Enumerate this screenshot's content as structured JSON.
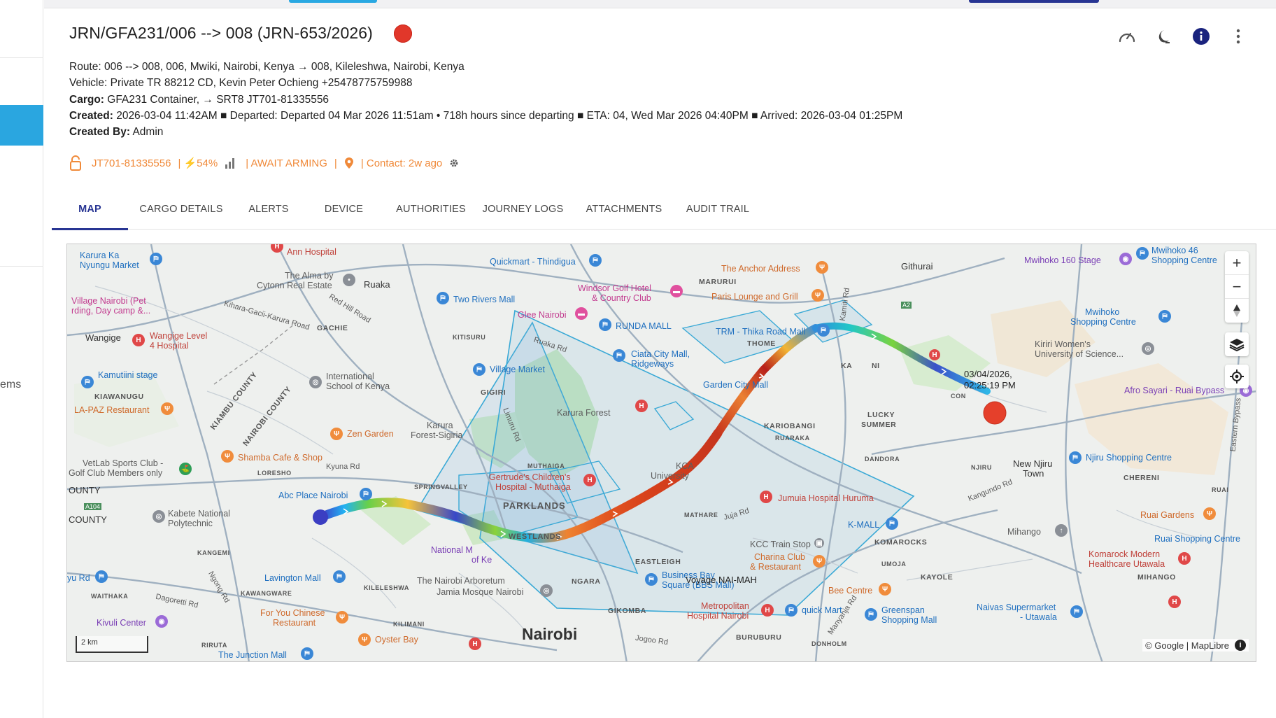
{
  "left_rail": {
    "label": "ems"
  },
  "header": {
    "title": "JRN/GFA231/006 --> 008 (JRN-653/2026)",
    "status_color": "#e1372a",
    "icons": [
      "speedometer-icon",
      "night-mode-icon",
      "info-icon",
      "more-vert-icon"
    ]
  },
  "details": {
    "route_label": "Route:",
    "route_value": " 006 --> 008, 006, Mwiki, Nairobi, Kenya → 008, Kileleshwa, Nairobi, Kenya",
    "vehicle_label": "Vehicle:",
    "vehicle_value": " Private TR 88212 CD, Kevin Peter Ochieng +25478775759988",
    "cargo_label": "Cargo:",
    "cargo_value": " GFA231 Container, → SRT8 JT701-81335556",
    "created_label": "Created:",
    "created_value": " 2026-03-04 11:42AM ■ Departed: Departed 04 Mar 2026 11:51am • 718h hours since departing ■ ETA: 04, Wed Mar 2026 04:40PM ■ Arrived: 2026-03-04 01:25PM",
    "created_by_label": "Created By:",
    "created_by_value": " Admin"
  },
  "device_status": {
    "device_id": "JT701-81335556",
    "battery": "| ⚡54%",
    "arming": "| AWAIT ARMING",
    "sep": "|",
    "contact": "| Contact: 2w ago",
    "accent": "#f08a3a"
  },
  "tabs": [
    "MAP",
    "CARGO DETAILS",
    "ALERTS",
    "DEVICE",
    "AUTHORITIES",
    "JOURNEY LOGS",
    "ATTACHMENTS",
    "AUDIT TRAIL"
  ],
  "map": {
    "end_time_line1": "03/04/2026,",
    "end_time_line2": "02:25:19 PM",
    "voyage_label": "Voyage NAI-MAH",
    "scale": "2 km",
    "attribution": "© Google | MapLibre",
    "labels": {
      "karura_ka": "Karura Ka",
      "nyungu": "Nyungu Market",
      "ann_hospital": "Ann Hospital",
      "quickmart": "Quickmart - Thindigua",
      "anchor": "The Anchor Address",
      "githurai": "Githurai",
      "mwihoko160": "Mwihoko 160 Stage",
      "mwihoko46a": "Mwihoko 46",
      "mwihoko46b": "Shopping Centre",
      "alma1": "The Alma by",
      "alma2": "Cytonn Real Estate",
      "ruaka": "Ruaka",
      "windsor1": "Windsor Golf Hotel",
      "windsor2": "& Country Club",
      "maruri": "MARURUI",
      "paris": "Paris Lounge and Grill",
      "village1": "Village Nairobi (Pet",
      "village2": "rding, Day camp &...",
      "two_rivers": "Two Rivers Mall",
      "glee": "Glee Nairobi",
      "mwihoko_sc1": "Mwihoko",
      "mwihoko_sc2": "Shopping Centre",
      "kihara": "Kihara-Gacii-Karura Road",
      "gachie": "GACHIE",
      "red_hill": "Red Hill Road",
      "runda": "RUNDA MALL",
      "trm": "TRM - Thika Road Mall",
      "thome": "THOME",
      "wangige": "Wangige",
      "wangige_h1": "Wangige Level",
      "wangige_h2": "4 Hospital",
      "kitisuru": "KITISURU",
      "ruaka_rd": "Ruaka Rd",
      "ciata1": "Ciata City Mall,",
      "ciata2": "Ridgeways",
      "kiriri1": "Kiriri Women's",
      "kiriri2": "University of Science...",
      "kamutiini": "Kamutiini stage",
      "intl1": "International",
      "intl2": "School of Kenya",
      "village_market": "Village Market",
      "garden_city": "Garden City Mall",
      "kiambu": "KIAMBU COUNTY",
      "nairobi_county": "NAIROBI COUNTY",
      "gigiri": "GIGIRI",
      "afro": "Afro Sayari - Ruai Bypass",
      "kiawanugu": "KIAWANUGU",
      "lapaz": "LA-PAZ Restaurant",
      "karura_forest": "Karura Forest",
      "kariobangi": "KARIOBANGI",
      "ruaraka": "RUARAKA",
      "lucky1": "LUCKY",
      "lucky2": "SUMMER",
      "karura_sig1": "Karura",
      "karura_sig2": "Forest-Sigiria",
      "zen": "Zen Garden",
      "limuru": "Limuru Rd",
      "vetlab1": "VetLab Sports Club -",
      "vetlab2": "Golf Club Members only",
      "shamba": "Shamba Cafe & Shop",
      "kyuna": "Kyuna Rd",
      "loresho": "LORESHO",
      "muthaiga": "MUTHAIGA",
      "gertrudes1": "Gertrude's Children's",
      "gertrudes2": "Hospital - Muthaiga",
      "kca1": "KCA",
      "kca2": "University",
      "dandora": "DANDORA",
      "njiru": "NJIRU",
      "new_njiru1": "New Njiru",
      "new_njiru2": "Town",
      "njiru_sc": "Njiru Shopping Centre",
      "chereni": "CHERENI",
      "county1": "OUNTY",
      "county2": "COUNTY",
      "abc": "Abc Place Nairobi",
      "spring": "SPRINGVALLEY",
      "parklands": "PARKLANDS",
      "jumuia": "Jumuia Hospital Huruma",
      "kangundo": "Kangundo Rd",
      "ruai": "RUAI",
      "eastern_bypass": "Eastern Bypass",
      "kabete1": "Kabete National",
      "kabete2": "Polytechnic",
      "mathare": "MATHARE",
      "juja": "Juja Rd",
      "kmall": "K-MALL",
      "ruai_gardens": "Ruai Gardens",
      "westlands": "WESTLANDS",
      "kangemi": "KANGEMI",
      "national1": "National M",
      "national2": "of Ke",
      "kcc": "KCC Train Stop",
      "komarocks": "KOMAROCKS",
      "mihango": "Mihango",
      "ruai_shopping": "Ruai Shopping Centre",
      "eastleigh": "EASTLEIGH",
      "charina1": "Charina Club",
      "charina2": "& Restaurant",
      "umoja": "UMOJA",
      "komarock1": "Komarock Modern",
      "komarock2": "Healthcare Utawala",
      "yu_rd": "yu Rd",
      "lavington": "Lavington Mall",
      "arboretum": "The Nairobi Arboretum",
      "ngara": "NGARA",
      "business1": "Business Bay",
      "business2": "Square (BBS Mall)",
      "kayole": "KAYOLE",
      "mihango2": "MIHANGO",
      "waithaka": "WAITHAKA",
      "dagoretti": "Dagoretti Rd",
      "kawangware": "KAWANGWARE",
      "kileleshwa": "KILELESHWA",
      "jamia": "Jamia Mosque Nairobi",
      "bee": "Bee Centre",
      "you_chinese1": "For You Chinese",
      "you_chinese2": "Restaurant",
      "gikomba": "GIKOMBA",
      "metropolitan1": "Metropolitan",
      "metropolitan2": "Hospital Nairobi",
      "quick_mart": "quick Mart",
      "greenspan1": "Greenspan",
      "greenspan2": "Shopping Mall",
      "naivas1": "Naivas Supermarket",
      "naivas2": "- Utawala",
      "kivuli": "Kivuli Center",
      "kilimani": "KILIMANI",
      "oyster": "Oyster Bay",
      "nairobi": "Nairobi",
      "manyanja": "Manyanja Rd",
      "jogoo": "Jogoo Rd",
      "buruburu": "BURUBURU",
      "donholm": "DONHOLM",
      "riruta": "RIRUTA",
      "junction": "The Junction Mall",
      "ngong": "Ngong Rd",
      "kamiti": "Kamiti Rd",
      "a2": "A2",
      "a104": "A104",
      "kahawa": "KA",
      "kahawa2": "NI",
      "con": "CON"
    }
  }
}
